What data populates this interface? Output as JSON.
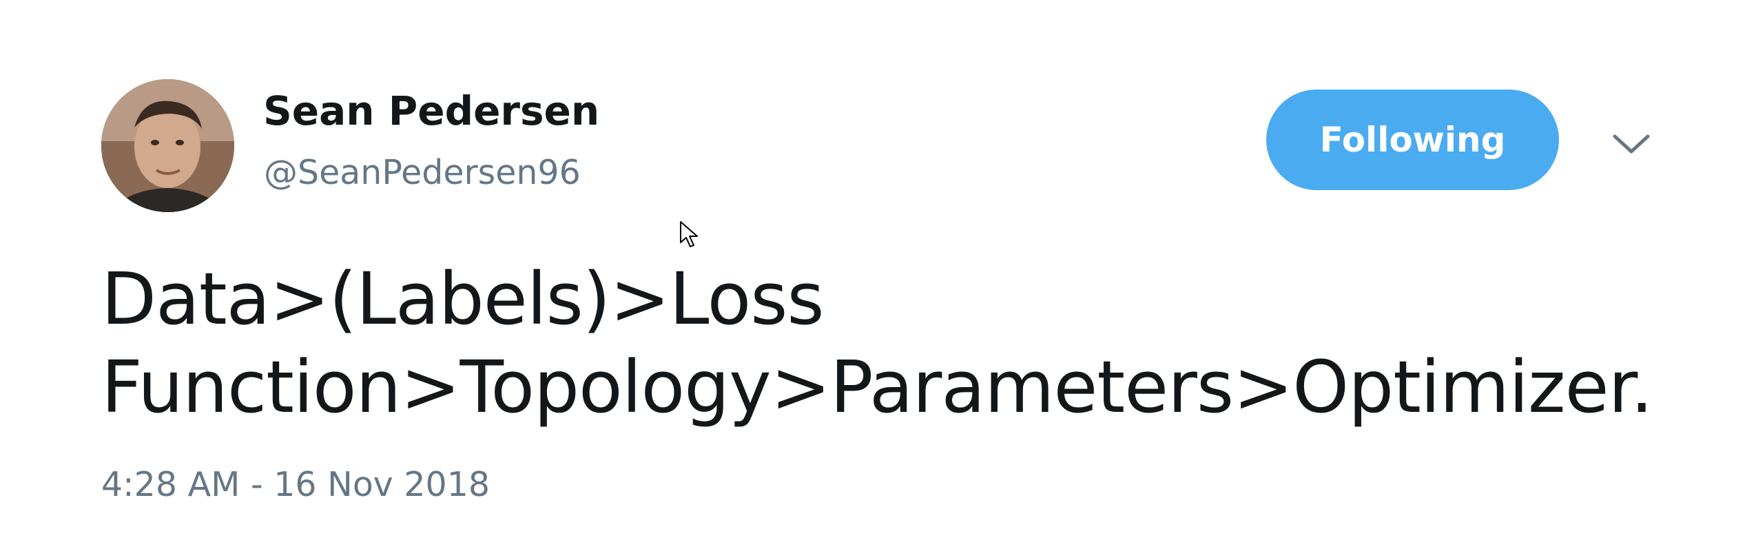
{
  "author": {
    "display_name": "Sean Pedersen",
    "handle": "@SeanPedersen96"
  },
  "actions": {
    "follow_label": "Following",
    "menu_icon": "chevron-down-icon"
  },
  "tweet": {
    "text_line_1": "Data>(Labels)>Loss",
    "text_line_2": "Function>Topology>Parameters>Optimizer.",
    "timestamp": "4:28 AM - 16 Nov 2018"
  },
  "colors": {
    "follow_button": "#4aabf1",
    "secondary_text": "#657786",
    "primary_text": "#14171a"
  }
}
